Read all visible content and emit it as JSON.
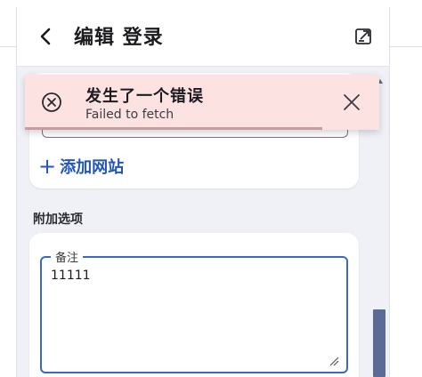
{
  "header": {
    "title": "编辑 登录",
    "back_icon": "chevron-left-icon",
    "popout_icon": "popout-window-icon"
  },
  "website_card": {
    "add_website_label": "添加网站",
    "add_icon": "plus-icon"
  },
  "additional_options": {
    "section_title": "附加选项",
    "notes": {
      "label": "备注",
      "value": "11111"
    }
  },
  "toast": {
    "title": "发生了一个错误",
    "message": "Failed to fetch",
    "status_icon": "error-circle-x-icon",
    "close_icon": "close-icon",
    "progress": 0.84
  },
  "colors": {
    "accent": "#2456b8",
    "focus_border": "#3a68c2",
    "toast_bg": "#fde2e2",
    "panel_bg": "#f0f1f7",
    "scrollbar": "#5a6c96"
  }
}
